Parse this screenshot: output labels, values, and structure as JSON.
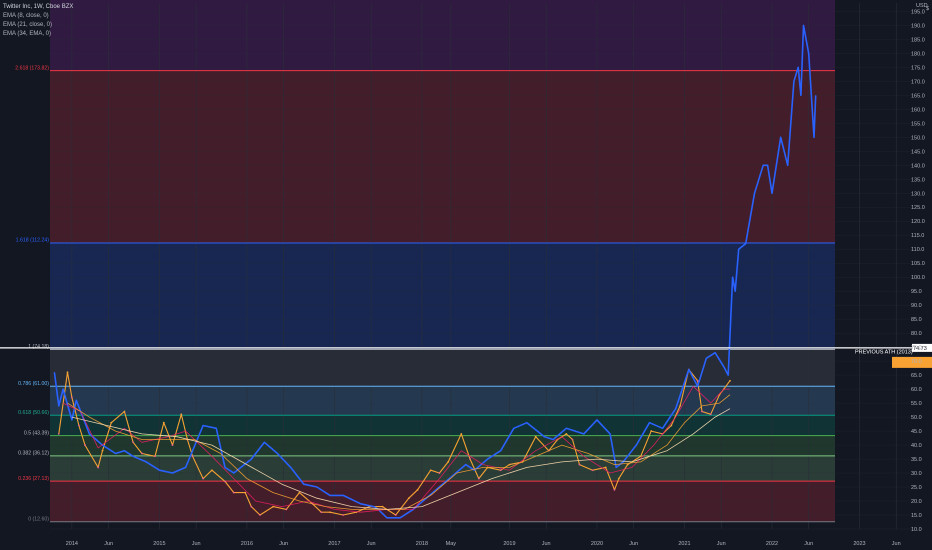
{
  "legend": {
    "title": "Twitter Inc, 1W, Cboe BZX",
    "ema_lines": [
      "EMA (8, close, 0)",
      "EMA (21, close, 0)",
      "EMA (34, EMA, 0)"
    ]
  },
  "price_axis": {
    "top_label": "USD",
    "currency_suffix": "$",
    "ticks": [
      195,
      190,
      185,
      180,
      175,
      170,
      165,
      160,
      155,
      150,
      145,
      140,
      135,
      130,
      125,
      120,
      115,
      110,
      105,
      100,
      95,
      90,
      85,
      80,
      75,
      70,
      65,
      60,
      55,
      50,
      45,
      40,
      35,
      30,
      25,
      20,
      15,
      10
    ]
  },
  "badges": {
    "ath_value": "74.73",
    "current_value": "",
    "ath_color": "#ffffff",
    "current_color": "#f7a232"
  },
  "annotation": {
    "text": "PREVIOUS ATH (2013)",
    "price": 74.73
  },
  "fib_levels": [
    {
      "label": "0 (12.60)",
      "price": 12.6,
      "zone_color": "#434651",
      "line_color": "#787b86",
      "text_color": "#787b86"
    },
    {
      "label": "0.236 (27.13)",
      "price": 27.13,
      "zone_color": "#f23645",
      "line_color": "#f23645",
      "text_color": "#f23645"
    },
    {
      "label": "0.382 (36.12)",
      "price": 36.12,
      "zone_color": "#81c784",
      "line_color": "#81c784",
      "text_color": "#b2b5be"
    },
    {
      "label": "0.5 (43.39)",
      "price": 43.39,
      "zone_color": "#4caf50",
      "line_color": "#4caf50",
      "text_color": "#b2b5be"
    },
    {
      "label": "0.618 (50.66)",
      "price": 50.66,
      "zone_color": "#089981",
      "line_color": "#089981",
      "text_color": "#22ab94"
    },
    {
      "label": "0.786 (61.00)",
      "price": 61.0,
      "zone_color": "#64b5f6",
      "line_color": "#64b5f6",
      "text_color": "#64b5f6"
    },
    {
      "label": "1 (74.18)",
      "price": 74.18,
      "zone_color": "#787b86",
      "line_color": "#b2b5be",
      "text_color": "#b2b5be"
    },
    {
      "label": "1.618 (112.24)",
      "price": 112.24,
      "zone_color": "#2962ff",
      "line_color": "#2962ff",
      "text_color": "#2962ff"
    },
    {
      "label": "2.618 (173.82)",
      "price": 173.82,
      "zone_color": "#f23645",
      "line_color": "#f23645",
      "text_color": "#f23645"
    },
    {
      "label": "",
      "price": 200,
      "zone_color": "#9c27b0",
      "line_color": "#9c27b0",
      "text_color": "#9c27b0"
    }
  ],
  "time_axis": [
    {
      "label": "2014",
      "date": 2014.0
    },
    {
      "label": "Jun",
      "date": 2014.42
    },
    {
      "label": "2015",
      "date": 2015.0
    },
    {
      "label": "Jun",
      "date": 2015.42
    },
    {
      "label": "2016",
      "date": 2016.0
    },
    {
      "label": "Jun",
      "date": 2016.42
    },
    {
      "label": "2017",
      "date": 2017.0
    },
    {
      "label": "Jun",
      "date": 2017.42
    },
    {
      "label": "2018",
      "date": 2018.0
    },
    {
      "label": "May",
      "date": 2018.33
    },
    {
      "label": "2019",
      "date": 2019.0
    },
    {
      "label": "Jun",
      "date": 2019.42
    },
    {
      "label": "2020",
      "date": 2020.0
    },
    {
      "label": "Jun",
      "date": 2020.42
    },
    {
      "label": "2021",
      "date": 2021.0
    },
    {
      "label": "Jun",
      "date": 2021.42
    },
    {
      "label": "2022",
      "date": 2022.0
    },
    {
      "label": "Jun",
      "date": 2022.42
    },
    {
      "label": "2023",
      "date": 2023.0
    },
    {
      "label": "Jun",
      "date": 2023.42
    }
  ],
  "colors": {
    "background": "#131722",
    "axis_text": "#b2b5be",
    "projection": "#2962ff",
    "candle_up": "#f7a232",
    "candle_down": "#f06292",
    "ema8": "#e91e63",
    "ema21": "#f7a232",
    "ema34": "#ffe0b2",
    "ath_line": "#ffffff"
  },
  "chart_data": {
    "type": "line",
    "title": "Twitter Inc, 1W, Cboe BZX",
    "x_unit": "year",
    "ylim": [
      10,
      198
    ],
    "xlim": [
      2013.75,
      2023.6
    ],
    "series": [
      {
        "name": "",
        "kind": "price",
        "x": [
          2013.85,
          2013.95,
          2014.0,
          2014.08,
          2014.15,
          2014.3,
          2014.35,
          2014.45,
          2014.6,
          2014.7,
          2014.8,
          2014.95,
          2015.05,
          2015.15,
          2015.25,
          2015.32,
          2015.38,
          2015.5,
          2015.6,
          2015.75,
          2015.85,
          2015.98,
          2016.05,
          2016.15,
          2016.3,
          2016.45,
          2016.6,
          2016.75,
          2016.85,
          2016.95,
          2017.1,
          2017.25,
          2017.4,
          2017.55,
          2017.7,
          2017.85,
          2017.95,
          2018.1,
          2018.2,
          2018.3,
          2018.45,
          2018.55,
          2018.65,
          2018.75,
          2018.9,
          2019.0,
          2019.15,
          2019.3,
          2019.45,
          2019.55,
          2019.65,
          2019.72,
          2019.8,
          2019.95,
          2020.1,
          2020.2,
          2020.25,
          2020.35,
          2020.5,
          2020.62,
          2020.75,
          2020.85,
          2020.95,
          2021.05,
          2021.15,
          2021.2,
          2021.3,
          2021.4,
          2021.45,
          2021.52
        ],
        "y": [
          44,
          66,
          57,
          47,
          40,
          32,
          38,
          48,
          52,
          41,
          37,
          36,
          48,
          40,
          51,
          42,
          36,
          28,
          31,
          27,
          23,
          23,
          18,
          15,
          18,
          17,
          23,
          19,
          16,
          16,
          15,
          16,
          18,
          18,
          15,
          21,
          24,
          31,
          30,
          34,
          44,
          35,
          28,
          32,
          31,
          33,
          34,
          43,
          38,
          42,
          44,
          42,
          33,
          31,
          32,
          24,
          28,
          33,
          36,
          45,
          44,
          47,
          54,
          67,
          63,
          52,
          51,
          58,
          60,
          63
        ]
      },
      {
        "name": "",
        "kind": "projection",
        "x": [
          2013.8,
          2013.85,
          2013.9,
          2014.0,
          2014.05,
          2014.2,
          2014.35,
          2014.5,
          2014.6,
          2014.7,
          2014.85,
          2015.0,
          2015.15,
          2015.3,
          2015.5,
          2015.65,
          2015.75,
          2015.85,
          2016.05,
          2016.2,
          2016.35,
          2016.5,
          2016.65,
          2016.8,
          2016.95,
          2017.1,
          2017.3,
          2017.45,
          2017.5,
          2017.6,
          2017.75,
          2017.9,
          2018.05,
          2018.2,
          2018.35,
          2018.5,
          2018.6,
          2018.75,
          2018.9,
          2019.05,
          2019.2,
          2019.4,
          2019.5,
          2019.65,
          2019.85,
          2020.0,
          2020.15,
          2020.22,
          2020.3,
          2020.45,
          2020.6,
          2020.75,
          2020.9,
          2021.05,
          2021.15,
          2021.25,
          2021.35,
          2021.45,
          2021.5,
          2021.55,
          2021.58,
          2021.62,
          2021.7,
          2021.8,
          2021.9,
          2021.95,
          2022.0,
          2022.1,
          2022.18,
          2022.25,
          2022.3,
          2022.33,
          2022.36,
          2022.42,
          2022.48,
          2022.5
        ],
        "y": [
          66,
          54,
          60,
          49,
          56,
          44,
          40,
          37,
          38,
          36,
          34,
          31,
          30,
          32,
          47,
          46,
          32,
          30,
          35,
          41,
          37,
          32,
          26,
          25,
          22,
          22,
          19,
          18,
          17,
          14,
          14,
          17,
          21,
          25,
          29,
          33,
          31,
          35,
          38,
          46,
          48,
          43,
          42,
          46,
          44,
          49,
          44,
          32,
          34,
          40,
          48,
          46,
          53,
          67,
          61,
          71,
          73,
          68,
          65,
          100,
          95,
          110,
          112,
          130,
          140,
          140,
          130,
          150,
          140,
          170,
          175,
          165,
          190,
          180,
          150,
          165
        ]
      },
      {
        "name": "EMA (8, close, 0)",
        "kind": "ema",
        "x": [
          2013.9,
          2014.1,
          2014.3,
          2014.6,
          2014.8,
          2015.1,
          2015.3,
          2015.6,
          2015.85,
          2016.1,
          2016.4,
          2016.7,
          2017.0,
          2017.3,
          2017.6,
          2017.9,
          2018.2,
          2018.45,
          2018.7,
          2019.0,
          2019.3,
          2019.6,
          2019.85,
          2020.15,
          2020.4,
          2020.65,
          2020.9,
          2021.1,
          2021.3,
          2021.45,
          2021.52
        ],
        "y": [
          55,
          52,
          39,
          46,
          41,
          43,
          45,
          36,
          28,
          20,
          18,
          20,
          17,
          16,
          17,
          17,
          28,
          38,
          33,
          31,
          38,
          43,
          36,
          30,
          32,
          40,
          50,
          61,
          55,
          60,
          60
        ]
      },
      {
        "name": "EMA (21, close, 0)",
        "kind": "ema",
        "x": [
          2013.95,
          2014.2,
          2014.5,
          2014.8,
          2015.1,
          2015.4,
          2015.7,
          2016.0,
          2016.3,
          2016.6,
          2016.9,
          2017.2,
          2017.5,
          2017.8,
          2018.1,
          2018.4,
          2018.7,
          2019.0,
          2019.3,
          2019.6,
          2019.9,
          2020.2,
          2020.5,
          2020.8,
          2021.0,
          2021.2,
          2021.4,
          2021.52
        ],
        "y": [
          55,
          50,
          45,
          42,
          42,
          42,
          37,
          28,
          23,
          20,
          18,
          17,
          17,
          17,
          22,
          30,
          32,
          32,
          36,
          40,
          37,
          33,
          34,
          40,
          48,
          54,
          55,
          58
        ]
      },
      {
        "name": "EMA (34, EMA, 0)",
        "kind": "ema",
        "x": [
          2014.0,
          2014.4,
          2014.8,
          2015.2,
          2015.6,
          2016.0,
          2016.4,
          2016.8,
          2017.2,
          2017.6,
          2018.0,
          2018.4,
          2018.8,
          2019.2,
          2019.6,
          2020.0,
          2020.4,
          2020.8,
          2021.1,
          2021.35,
          2021.52
        ],
        "y": [
          50,
          47,
          44,
          43,
          40,
          33,
          26,
          21,
          18,
          17,
          18,
          23,
          28,
          32,
          34,
          35,
          34,
          38,
          44,
          50,
          53
        ]
      }
    ]
  }
}
